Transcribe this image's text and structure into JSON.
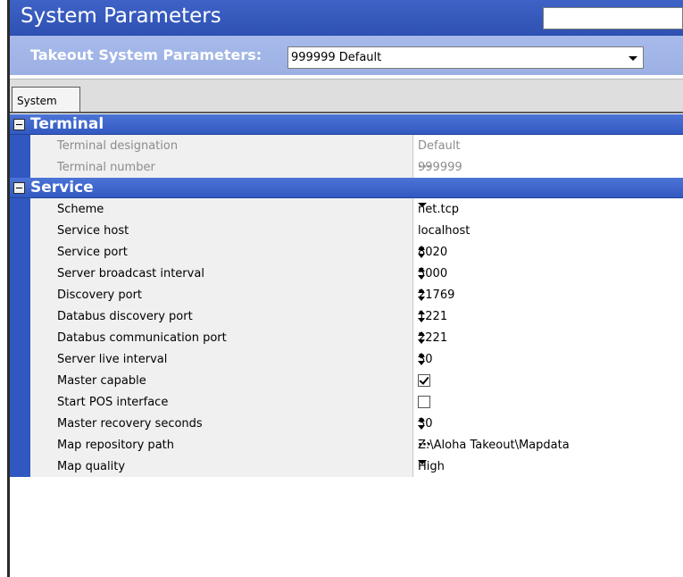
{
  "header": {
    "title": "System Parameters",
    "search_value": "",
    "selector_label": "Takeout System Parameters:",
    "selector_value": "999999 Default"
  },
  "tabs": [
    {
      "label": "System",
      "active": true
    }
  ],
  "categories": [
    {
      "label": "Terminal",
      "rows": [
        {
          "name": "Terminal designation",
          "value": "Default",
          "editor": "text",
          "disabled": true
        },
        {
          "name": "Terminal number",
          "value": "999999",
          "editor": "ellipsis",
          "disabled": true
        }
      ]
    },
    {
      "label": "Service",
      "rows": [
        {
          "name": "Scheme",
          "value": "net.tcp",
          "editor": "dropdown"
        },
        {
          "name": "Service host",
          "value": "localhost",
          "editor": "text"
        },
        {
          "name": "Service port",
          "value": "8020",
          "editor": "spinner"
        },
        {
          "name": "Server broadcast interval",
          "value": "5000",
          "editor": "spinner"
        },
        {
          "name": "Discovery port",
          "value": "21769",
          "editor": "spinner"
        },
        {
          "name": "Databus discovery port",
          "value": "1221",
          "editor": "spinner"
        },
        {
          "name": "Databus communication port",
          "value": "2221",
          "editor": "spinner"
        },
        {
          "name": "Server live interval",
          "value": "30",
          "editor": "spinner"
        },
        {
          "name": "Master capable",
          "value": "",
          "editor": "checkbox",
          "checked": true
        },
        {
          "name": "Start POS interface",
          "value": "",
          "editor": "checkbox",
          "checked": false
        },
        {
          "name": "Master recovery seconds",
          "value": "30",
          "editor": "spinner"
        },
        {
          "name": "Map repository path",
          "value": "Z:\\Aloha Takeout\\Mapdata",
          "editor": "ellipsis"
        },
        {
          "name": "Map quality",
          "value": "High",
          "editor": "dropdown"
        }
      ]
    }
  ],
  "icons": {
    "collapse": "minus-toggle-icon",
    "dropdown": "chevron-down-icon",
    "spinner": "spin-arrows-icon",
    "ellipsis": "ellipsis-icon",
    "checkbox": "checkbox-icon"
  },
  "colors": {
    "title_bar": "#3a5ec3",
    "sub_bar": "#a3b6e8",
    "category_bar": "#3d65cc",
    "row_gutter": "#3058c0",
    "disabled_text": "#8c8c8c"
  }
}
